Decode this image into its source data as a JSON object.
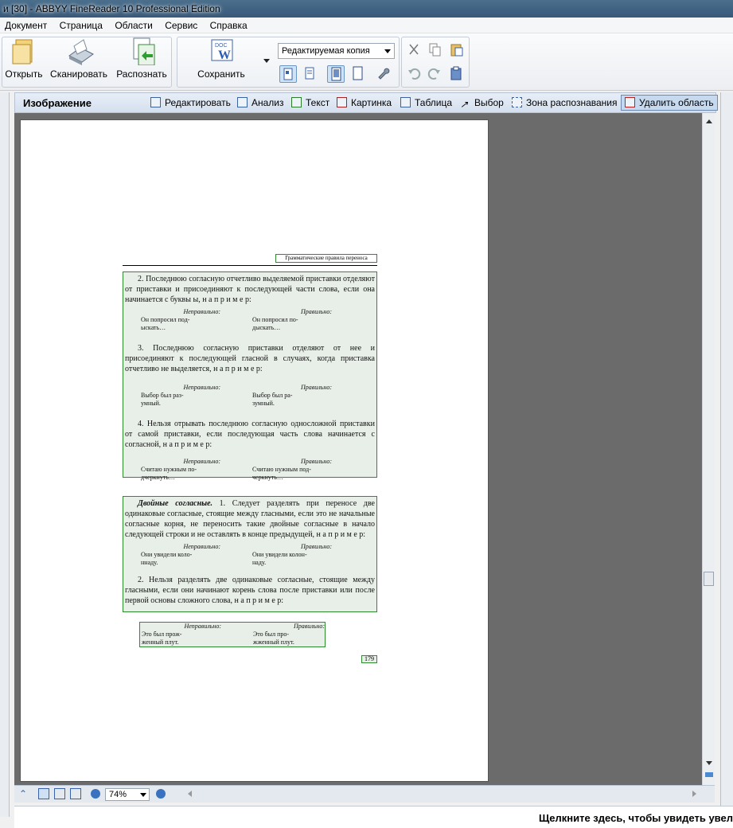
{
  "window": {
    "title": "и [30] - ABBYY FineReader 10 Professional Edition"
  },
  "menu": [
    "Документ",
    "Страница",
    "Области",
    "Сервис",
    "Справка"
  ],
  "toolbar": {
    "open": "Открыть",
    "scan": "Сканировать",
    "recognize": "Распознать",
    "save": "Сохранить",
    "save_format": "Редактируемая копия"
  },
  "image_panel": {
    "title": "Изображение",
    "tools": [
      "Редактировать",
      "Анализ",
      "Текст",
      "Картинка",
      "Таблица",
      "Выбор",
      "Зона распознавания",
      "Удалить область"
    ]
  },
  "document": {
    "header": "Грамматические правила переноса",
    "p2": "2. Последнюю согласную отчетливо выделяемой приставки отделяют от приставки и присоединяют к последующей части слова, если она начинается с буквы ы, н а п р и м е р:",
    "ex_wrong": "Неправильно:",
    "ex_right": "Правильно:",
    "ex1_wrong": [
      "Он попросил под-",
      "ыскать…"
    ],
    "ex1_right": [
      "Он попросил по-",
      "дыскать…"
    ],
    "p3": "3. Последнюю согласную приставки отделяют от нее и присоединяют к последующей гласной в случаях, когда приставка отчетливо не выделяется, н а п р и м е р:",
    "ex2_wrong": [
      "Выбор был раз-",
      "умный."
    ],
    "ex2_right": [
      "Выбор был ра-",
      "зумный."
    ],
    "p4": "4. Нельзя отрывать последнюю согласную односложной приставки от самой приставки, если последующая часть слова начинается с согласной, н а п р и м е р:",
    "ex3_wrong": [
      "Считаю нужным по-",
      "дчеркнуть…"
    ],
    "ex3_right": [
      "Считаю нужным под-",
      "черкнуть…"
    ],
    "dbl_title": "Двойные согласные.",
    "dbl_p1": "1. Следует разделять при переносе две одинаковые согласные, стоящие между гласными, если это не начальные согласные корня, не переносить такие двойные согласные в начало следующей строки и не оставлять в конце предыдущей, н а п р и м е р:",
    "ex4_wrong": [
      "Они увидели коло-",
      "ннаду."
    ],
    "ex4_right": [
      "Они увидели колон-",
      "наду."
    ],
    "dbl_p2": "2. Нельзя разделять две одинаковые согласные, стоящие между гласными, если они начинают корень слова после приставки или после первой основы сложного слова, н а п р и м е р:",
    "ex5_wrong": [
      "Это был прож-",
      "женный плут."
    ],
    "ex5_right": [
      "Это был про-",
      "жженный плут."
    ],
    "page_number": "179"
  },
  "bottom": {
    "zoom": "74%"
  },
  "status": "Щелкните здесь, чтобы увидеть увел"
}
